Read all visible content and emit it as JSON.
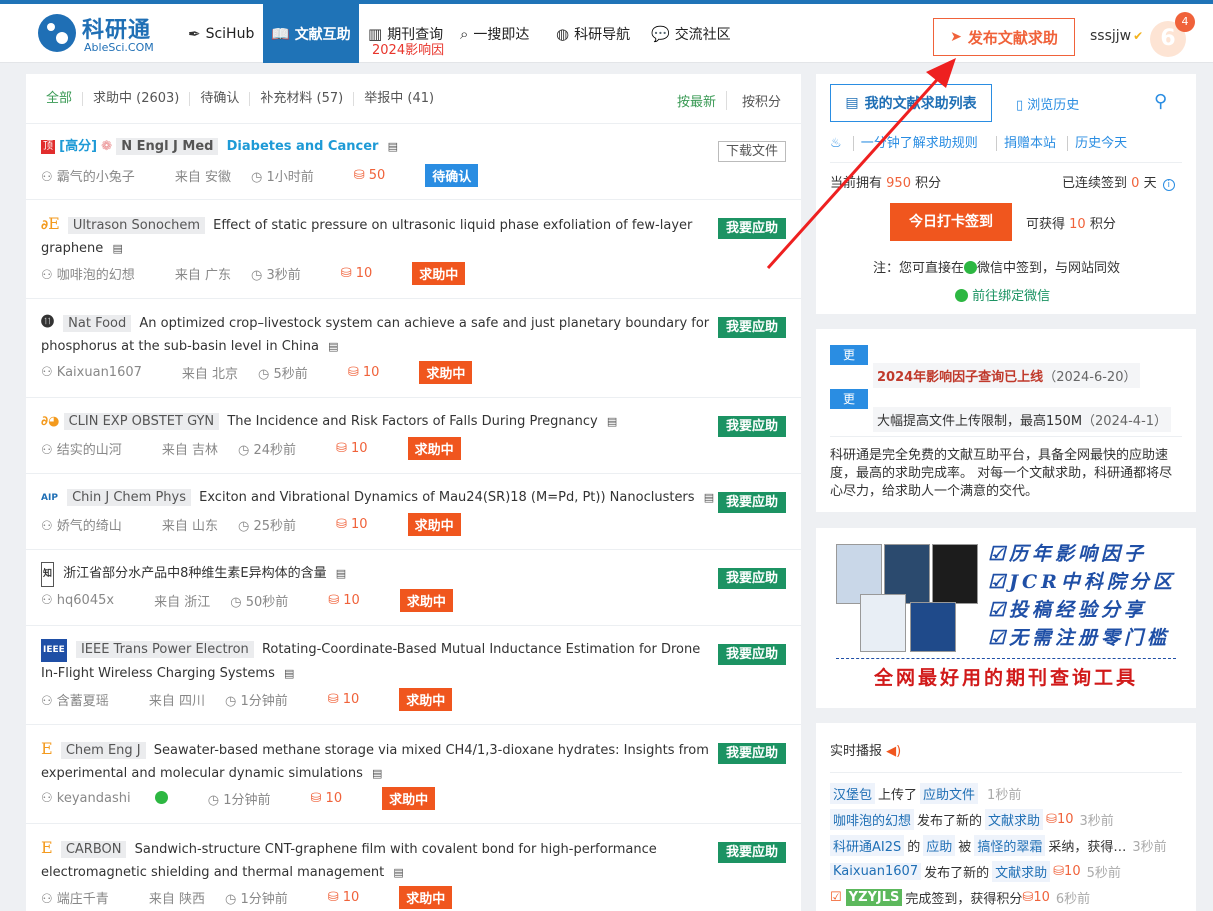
{
  "brand": {
    "name_cn": "科研通",
    "name_en": "AbleSci.COM"
  },
  "nav": [
    {
      "label": "SciHub",
      "icon": "feather-icon"
    },
    {
      "label": "文献互助",
      "icon": "book-icon",
      "active": true
    },
    {
      "label": "期刊查询",
      "icon": "books-icon",
      "sub": "2024影响因"
    },
    {
      "label": "一搜即达",
      "icon": "search-icon"
    },
    {
      "label": "科研导航",
      "icon": "globe-icon"
    },
    {
      "label": "交流社区",
      "icon": "chat-icon"
    }
  ],
  "header": {
    "publish_label": "发布文献求助",
    "username": "sssjjw",
    "avatar_text": "6",
    "badge_count": "4"
  },
  "filters": {
    "all": "全部",
    "helping": "求助中 (2603)",
    "pending": "待确认",
    "supplement": "补充材料 (57)",
    "report": "举报中 (41)",
    "sort_newest": "按最新",
    "sort_points": "按积分"
  },
  "items": [
    {
      "journal": "N Engl J Med",
      "title": "Diabetes and Cancer",
      "top_tag": "顶",
      "high_tag": "[高分]",
      "user": "霸气的小兔子",
      "from": "来自 安徽",
      "time": "1小时前",
      "points": "50",
      "status": "待确认",
      "action": "下载文件"
    },
    {
      "journal": "Ultrason Sonochem",
      "title": "Effect of static pressure on ultrasonic liquid phase exfoliation of few-layer graphene",
      "user": "咖啡泡的幻想",
      "from": "来自 广东",
      "time": "3秒前",
      "points": "10",
      "status": "求助中",
      "action": "我要应助"
    },
    {
      "journal": "Nat Food",
      "title": "An optimized crop–livestock system can achieve a safe and just planetary boundary for phosphorus at the sub-basin level in China",
      "user": "Kaixuan1607",
      "from": "来自 北京",
      "time": "5秒前",
      "points": "10",
      "status": "求助中",
      "action": "我要应助"
    },
    {
      "journal": "CLIN EXP OBSTET GYN",
      "title": "The Incidence and Risk Factors of Falls During Pregnancy",
      "user": "结实的山河",
      "from": "来自 吉林",
      "time": "24秒前",
      "points": "10",
      "status": "求助中",
      "action": "我要应助"
    },
    {
      "journal": "Chin J Chem Phys",
      "title": "Exciton and Vibrational Dynamics of Mau24(SR)18 (M=Pd, Pt)) Nanoclusters",
      "user": "娇气的绮山",
      "from": "来自 山东",
      "time": "25秒前",
      "points": "10",
      "status": "求助中",
      "action": "我要应助"
    },
    {
      "journal": "",
      "title": "浙江省部分水产品中8种维生素E异构体的含量",
      "user": "hq6045x",
      "from": "来自 浙江",
      "time": "50秒前",
      "points": "10",
      "status": "求助中",
      "action": "我要应助"
    },
    {
      "journal": "IEEE Trans Power Electron",
      "title": "Rotating-Coordinate-Based Mutual Inductance Estimation for Drone In-Flight Wireless Charging Systems",
      "user": "含蓄夏瑶",
      "from": "来自 四川",
      "time": "1分钟前",
      "points": "10",
      "status": "求助中",
      "action": "我要应助"
    },
    {
      "journal": "Chem Eng J",
      "title": "Seawater-based methane storage via mixed CH4/1,3-dioxane hydrates: Insights from experimental and molecular dynamic simulations",
      "user": "keyandashi",
      "from": "",
      "time": "1分钟前",
      "points": "10",
      "status": "求助中",
      "action": "我要应助"
    },
    {
      "journal": "CARBON",
      "title": "Sandwich-structure CNT-graphene film with covalent bond for high-performance electromagnetic shielding and thermal management",
      "user": "端庄千青",
      "from": "来自 陕西",
      "time": "1分钟前",
      "points": "10",
      "status": "求助中",
      "action": "我要应助"
    }
  ],
  "sidebar": {
    "my_list": "我的文献求助列表",
    "history": "浏览历史",
    "link1": "一分钟了解求助规则",
    "link2": "捐赠本站",
    "link3": "历史今天",
    "points_prefix": "当前拥有",
    "points_value": "950",
    "points_suffix": "积分",
    "streak_prefix": "已连续签到",
    "streak_value": "0",
    "streak_suffix": "天",
    "checkin": "今日打卡签到",
    "earn_prefix": "可获得",
    "earn_value": "10",
    "earn_suffix": "积分",
    "note": "注：您可直接在",
    "note2": "微信中签到，与网站同效",
    "bind": "前往绑定微信"
  },
  "updates": {
    "tag": "更",
    "u1": "2024年影响因子查询已上线",
    "u1_date": "（2024-6-20）",
    "u2": "大幅提高文件上传限制，最高150M",
    "u2_date": "（2024-4-1）",
    "intro": "科研通是完全免费的文献互助平台，具备全网最快的应助速度，最高的求助完成率。 对每一个文献求助，科研通都将尽心尽力，给求助人一个满意的交代。"
  },
  "promo": {
    "l1": "☑历年影响因子",
    "l2": "☑JCR中科院分区",
    "l3": "☑投稿经验分享",
    "l4": "☑无需注册零门槛",
    "bottom": "全网最好用的期刊查询工具"
  },
  "live": {
    "title": "实时播报",
    "rows": [
      {
        "user": "汉堡包",
        "a": "上传了",
        "link": "应助文件",
        "time": "1秒前"
      },
      {
        "user": "咖啡泡的幻想",
        "a": "发布了新的",
        "link": "文献求助",
        "pts": "10",
        "time": "3秒前"
      },
      {
        "user": "科研通AI2S",
        "a": "的",
        "link": "应助",
        "b": "被",
        "link2": "搞怪的翠霜",
        "c": "采纳，获得…",
        "time": "3秒前"
      },
      {
        "user": "Kaixuan1607",
        "a": "发布了新的",
        "link": "文献求助",
        "pts": "10",
        "time": "5秒前"
      },
      {
        "user": "YZYJLS",
        "a": "完成签到，获得积分",
        "pts": "10",
        "time": "6秒前"
      }
    ]
  },
  "colors": {
    "brand": "#1f73b7",
    "accent": "#f0623a",
    "respond": "#1c9363",
    "wait": "#2a8de2"
  }
}
